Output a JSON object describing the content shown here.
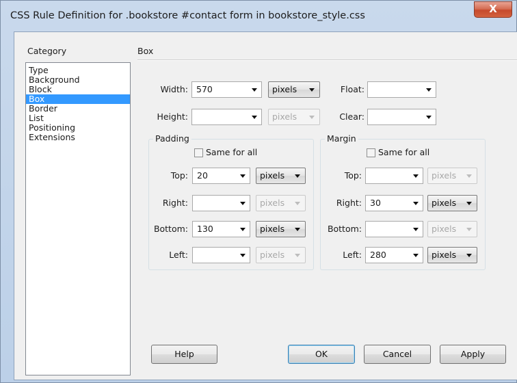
{
  "window": {
    "title": "CSS Rule Definition for .bookstore #contact form in bookstore_style.css",
    "close_glyph": "X"
  },
  "category": {
    "label": "Category",
    "items": [
      "Type",
      "Background",
      "Block",
      "Box",
      "Border",
      "List",
      "Positioning",
      "Extensions"
    ],
    "selected": "Box"
  },
  "panel": {
    "title": "Box"
  },
  "box": {
    "width": {
      "label": "Width:",
      "value": "570",
      "unit": "pixels",
      "unit_enabled": true
    },
    "height": {
      "label": "Height:",
      "value": "",
      "unit": "pixels",
      "unit_enabled": false
    },
    "float": {
      "label": "Float:",
      "value": ""
    },
    "clear": {
      "label": "Clear:",
      "value": ""
    }
  },
  "padding": {
    "legend": "Padding",
    "same_for_all": {
      "label": "Same for all",
      "checked": false
    },
    "top": {
      "label": "Top:",
      "value": "20",
      "unit": "pixels",
      "unit_enabled": true
    },
    "right": {
      "label": "Right:",
      "value": "",
      "unit": "pixels",
      "unit_enabled": false
    },
    "bottom": {
      "label": "Bottom:",
      "value": "130",
      "unit": "pixels",
      "unit_enabled": true
    },
    "left": {
      "label": "Left:",
      "value": "",
      "unit": "pixels",
      "unit_enabled": false
    }
  },
  "margin": {
    "legend": "Margin",
    "same_for_all": {
      "label": "Same for all",
      "checked": false
    },
    "top": {
      "label": "Top:",
      "value": "",
      "unit": "pixels",
      "unit_enabled": false
    },
    "right": {
      "label": "Right:",
      "value": "30",
      "unit": "pixels",
      "unit_enabled": true
    },
    "bottom": {
      "label": "Bottom:",
      "value": "",
      "unit": "pixels",
      "unit_enabled": false
    },
    "left": {
      "label": "Left:",
      "value": "280",
      "unit": "pixels",
      "unit_enabled": true
    }
  },
  "buttons": {
    "help": "Help",
    "ok": "OK",
    "cancel": "Cancel",
    "apply": "Apply"
  },
  "colors": {
    "selection": "#3399ff",
    "close_button": "#c64a2c",
    "title_bar": "#c9d9ec"
  },
  "icons": {
    "close": "close-icon",
    "dropdown": "chevron-down-icon"
  }
}
